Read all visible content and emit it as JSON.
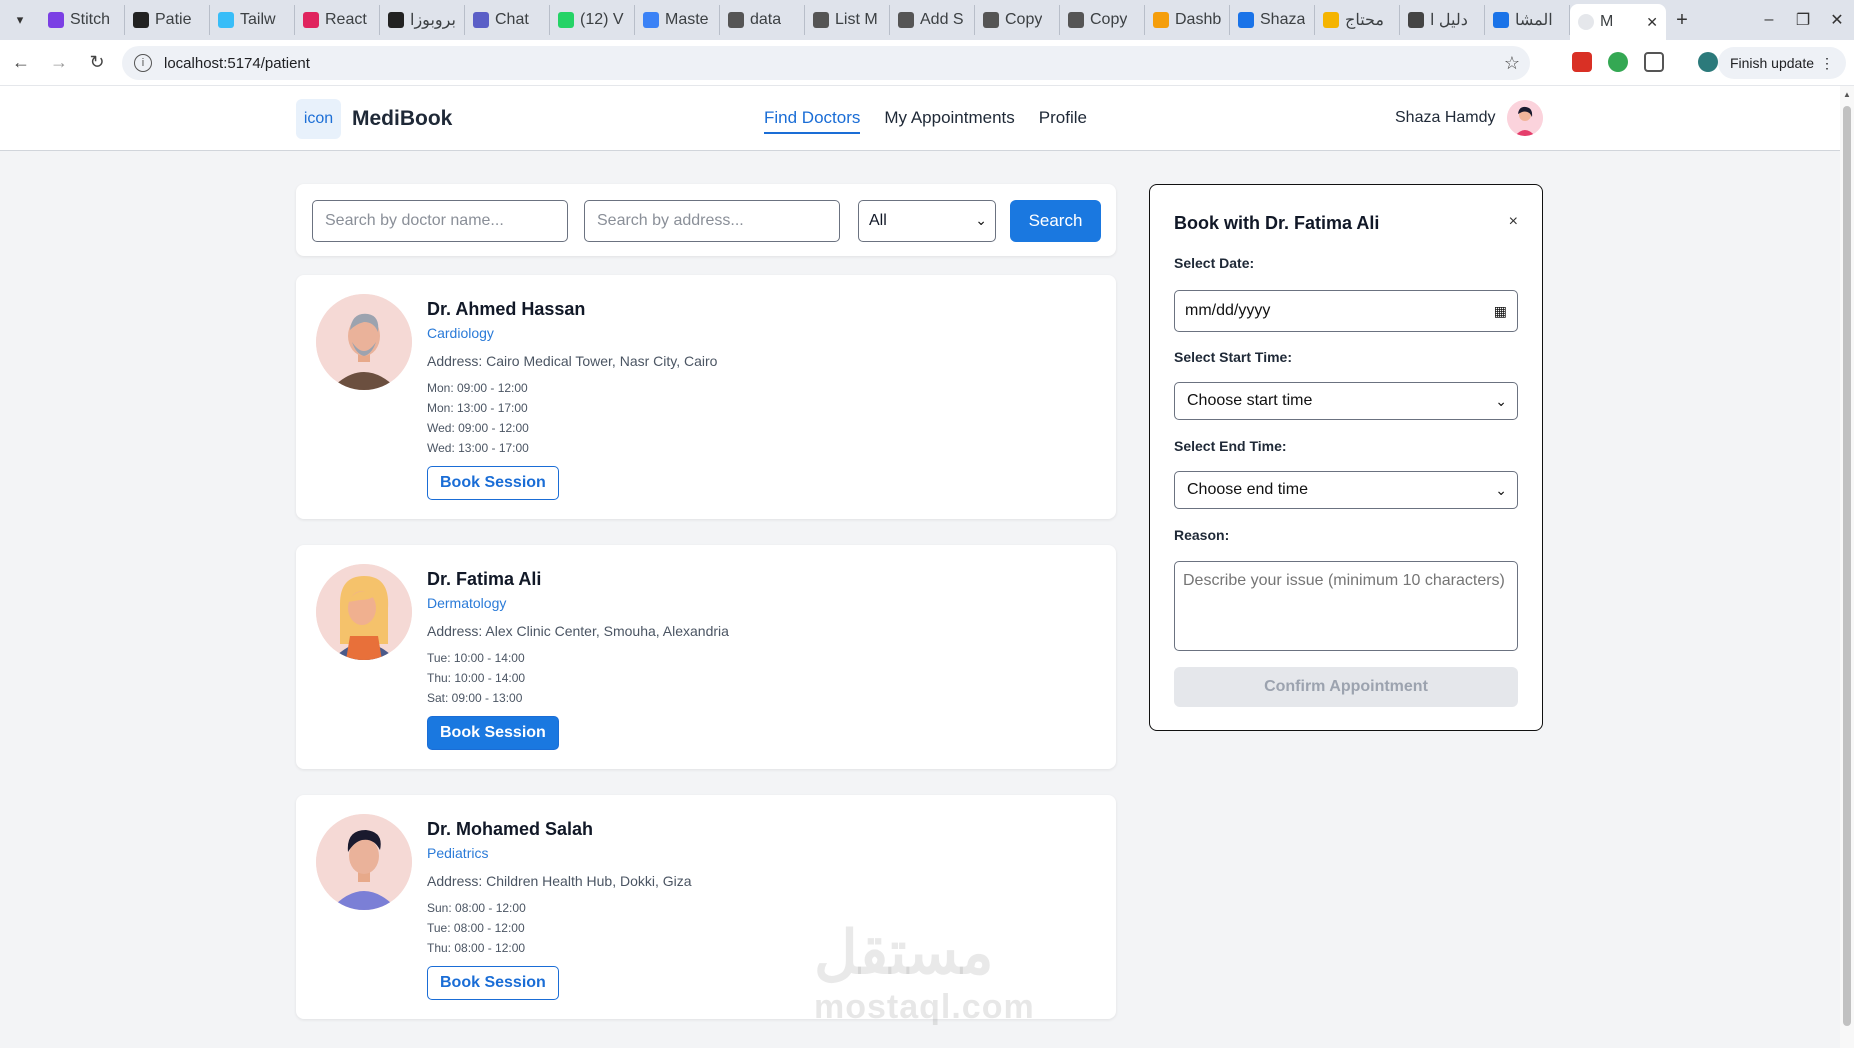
{
  "browser": {
    "tabs": [
      {
        "title": "Stitch",
        "color": "#7b3fe4"
      },
      {
        "title": "Patie",
        "color": "#222222"
      },
      {
        "title": "Tailw",
        "color": "#38bdf8"
      },
      {
        "title": "React",
        "color": "#e0245e"
      },
      {
        "title": "بروبوزا",
        "color": "#222222"
      },
      {
        "title": "Chat",
        "color": "#5b5fc7"
      },
      {
        "title": "(12) V",
        "color": "#25d366"
      },
      {
        "title": "Maste",
        "color": "#3b82f6"
      },
      {
        "title": "data",
        "color": "#555555"
      },
      {
        "title": "List M",
        "color": "#555555"
      },
      {
        "title": "Add S",
        "color": "#555555"
      },
      {
        "title": "Copy",
        "color": "#555555"
      },
      {
        "title": "Copy",
        "color": "#555555"
      },
      {
        "title": "Dashb",
        "color": "#f59e0b"
      },
      {
        "title": "Shaza",
        "color": "#1a73e8"
      },
      {
        "title": "محتاج",
        "color": "#f5b400"
      },
      {
        "title": "دليل ا",
        "color": "#444444"
      },
      {
        "title": "المشا",
        "color": "#1a73e8"
      }
    ],
    "active_tab": {
      "title": "M"
    },
    "url": "localhost:5174/patient",
    "finish_update": "Finish update"
  },
  "header": {
    "logo_text": "icon",
    "brand": "MediBook",
    "nav": [
      "Find Doctors",
      "My Appointments",
      "Profile"
    ],
    "user_name": "Shaza Hamdy"
  },
  "search": {
    "name_placeholder": "Search by doctor name...",
    "address_placeholder": "Search by address...",
    "filter_value": "All",
    "button": "Search"
  },
  "doctors": [
    {
      "name": "Dr. Ahmed Hassan",
      "specialty": "Cardiology",
      "address": "Address: Cairo Medical Tower, Nasr City, Cairo",
      "slots": [
        "Mon: 09:00 - 12:00",
        "Mon: 13:00 - 17:00",
        "Wed: 09:00 - 12:00",
        "Wed: 13:00 - 17:00"
      ],
      "button": "Book Session"
    },
    {
      "name": "Dr. Fatima Ali",
      "specialty": "Dermatology",
      "address": "Address: Alex Clinic Center, Smouha, Alexandria",
      "slots": [
        "Tue: 10:00 - 14:00",
        "Thu: 10:00 - 14:00",
        "Sat: 09:00 - 13:00"
      ],
      "button": "Book Session"
    },
    {
      "name": "Dr. Mohamed Salah",
      "specialty": "Pediatrics",
      "address": "Address: Children Health Hub, Dokki, Giza",
      "slots": [
        "Sun: 08:00 - 12:00",
        "Tue: 08:00 - 12:00",
        "Thu: 08:00 - 12:00"
      ],
      "button": "Book Session"
    }
  ],
  "booking": {
    "title": "Book with Dr. Fatima Ali",
    "close": "×",
    "date_label": "Select Date:",
    "date_value": "mm/dd/yyyy",
    "start_label": "Select Start Time:",
    "start_value": "Choose start time",
    "end_label": "Select End Time:",
    "end_value": "Choose end time",
    "reason_label": "Reason:",
    "reason_placeholder": "Describe your issue (minimum 10 characters)",
    "confirm": "Confirm Appointment"
  },
  "watermark": {
    "arabic": "مستقل",
    "latin": "mostaql.com"
  }
}
